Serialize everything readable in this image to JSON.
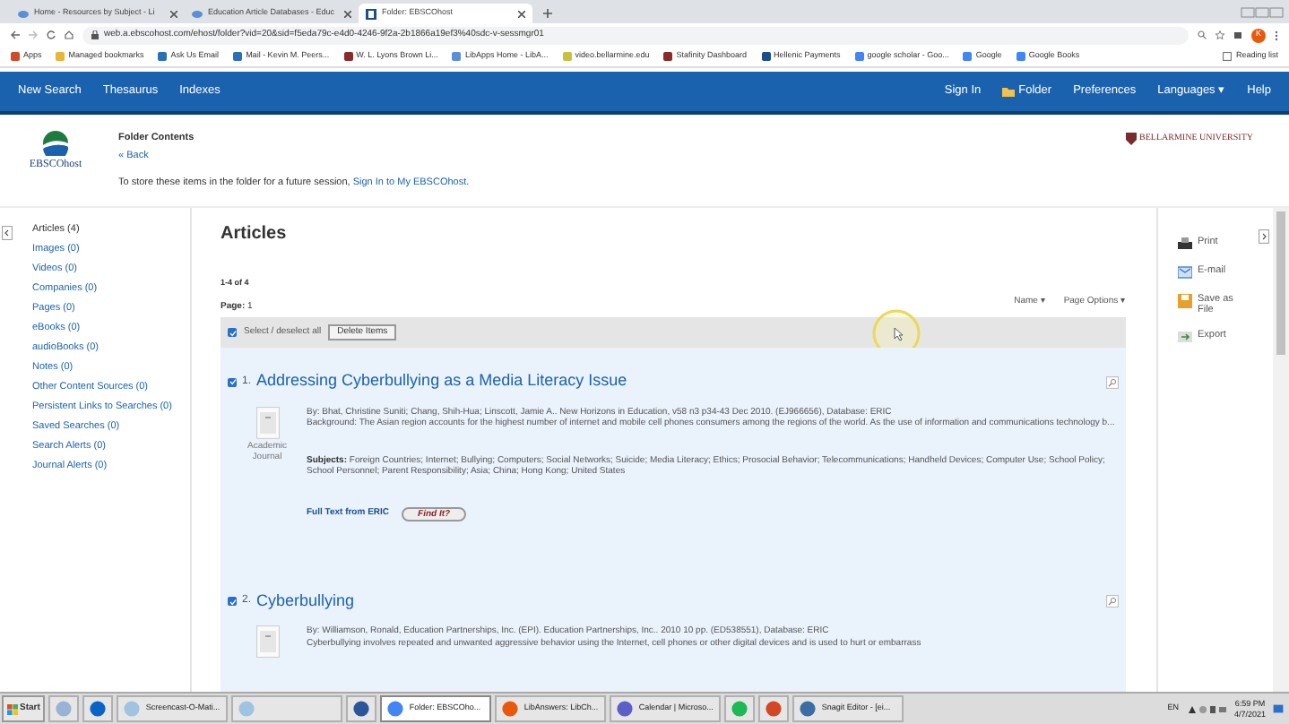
{
  "browser": {
    "tabs": [
      {
        "title": "Home - Resources by Subject - Li",
        "selected": false
      },
      {
        "title": "Education Article Databases - Educ",
        "selected": false
      },
      {
        "title": "Folder: EBSCOhost",
        "selected": true
      }
    ],
    "url": "web.a.ebscohost.com/ehost/folder?vid=20&sid=f5eda79c-e4d0-4246-9f2a-2b1866a19ef3%40sdc-v-sessmgr01",
    "profile_initial": "K",
    "bookmarks": [
      "Apps",
      "Managed bookmarks",
      "Ask Us Email",
      "Mail - Kevin M. Peers...",
      "W. L. Lyons Brown Li...",
      "LibApps Home - LibA...",
      "video.bellarmine.edu",
      "Stafinity Dashboard",
      "Hellenic Payments",
      "google scholar - Goo...",
      "Google",
      "Google Books"
    ],
    "reading_list": "Reading list"
  },
  "nav": {
    "left": [
      "New Search",
      "Thesaurus",
      "Indexes"
    ],
    "right": [
      "Sign In",
      "Folder",
      "Preferences",
      "Languages ▾",
      "Help"
    ]
  },
  "header": {
    "logo": "EBSCOhost",
    "title": "Folder Contents",
    "back": "« Back",
    "note": "To store these items in the folder for a future session, ",
    "note_link": "Sign In to My EBSCOhost.",
    "university": "BELLARMINE UNIVERSITY"
  },
  "sidebar": {
    "items": [
      {
        "label": "Articles",
        "count": "(4)",
        "selected": true
      },
      {
        "label": "Images",
        "count": "(0)",
        "selected": false
      },
      {
        "label": "Videos",
        "count": "(0)",
        "selected": false
      },
      {
        "label": "Companies",
        "count": "(0)",
        "selected": false
      },
      {
        "label": "Pages",
        "count": "(0)",
        "selected": false
      },
      {
        "label": "eBooks",
        "count": "(0)",
        "selected": false
      },
      {
        "label": "audioBooks",
        "count": "(0)",
        "selected": false
      },
      {
        "label": "Notes",
        "count": "(0)",
        "selected": false
      },
      {
        "label": "Other Content Sources",
        "count": "(0)",
        "selected": false
      },
      {
        "label": "Persistent Links to Searches",
        "count": "(0)",
        "selected": false
      },
      {
        "label": "Saved Searches",
        "count": "(0)",
        "selected": false
      },
      {
        "label": "Search Alerts",
        "count": "(0)",
        "selected": false
      },
      {
        "label": "Journal Alerts",
        "count": "(0)",
        "selected": false
      }
    ]
  },
  "main": {
    "heading": "Articles",
    "range": "1-4 of 4",
    "page_label": "Page:",
    "page": "1",
    "sort": "Name ▾",
    "page_options": "Page Options ▾",
    "select_all": {
      "label": "Select / deselect all",
      "checked": true
    },
    "delete_button": "Delete Items",
    "results": [
      {
        "number": "1.",
        "title": "Addressing Cyberbullying as a Media Literacy Issue",
        "checked": true,
        "type": "Academic Journal",
        "byline": "By: Bhat, Christine Suniti; Chang, Shih-Hua; Linscott, Jamie A.. New Horizons in Education, v58 n3 p34-43 Dec 2010. (EJ966656), Database: ERIC",
        "abstract": "Background: The Asian region accounts for the highest number of internet and mobile cell phones consumers among the regions of the world. As the use of information and communications technology b...",
        "subjects_label": "Subjects:",
        "subjects": "Foreign Countries; Internet; Bullying; Computers; Social Networks; Suicide; Media Literacy; Ethics; Prosocial Behavior; Telecommunications; Handheld Devices; Computer Use; School Policy; School Personnel; Parent Responsibility; Asia; China; Hong Kong; United States",
        "full_text": "Full Text from ERIC",
        "find_button": "Find It?"
      },
      {
        "number": "2.",
        "title": "Cyberbullying",
        "checked": true,
        "byline": "By: Williamson, Ronald, Education Partnerships, Inc. (EPI). Education Partnerships, Inc.. 2010 10 pp. (ED538551), Database: ERIC",
        "abstract": "Cyberbullying involves repeated and unwanted aggressive behavior using the Internet, cell phones or other digital devices and is used to hurt or embarrass"
      }
    ]
  },
  "tools": [
    {
      "kind": "print",
      "label": "Print"
    },
    {
      "kind": "email",
      "label": "E-mail"
    },
    {
      "kind": "save",
      "label": "Save as File"
    },
    {
      "kind": "export",
      "label": "Export"
    }
  ],
  "taskbar": {
    "start": "Start",
    "items": [
      {
        "kind": "files",
        "selected": false
      },
      {
        "kind": "outlook",
        "selected": false
      },
      {
        "kind": "screencast",
        "label": "Screencast-O-Mati...",
        "selected": false
      },
      {
        "kind": "window",
        "selected": false
      },
      {
        "kind": "word",
        "selected": false
      },
      {
        "kind": "chrome",
        "label": "Folder: EBSCOho...",
        "selected": true
      },
      {
        "kind": "firefox",
        "label": "LibAnswers: LibCh...",
        "selected": false
      },
      {
        "kind": "teams",
        "label": "Calendar | Microso...",
        "selected": false
      },
      {
        "kind": "spotify",
        "selected": false
      },
      {
        "kind": "powerpoint",
        "selected": false
      },
      {
        "kind": "snagit",
        "label": "Snagit Editor - [ei...",
        "selected": false
      }
    ],
    "language": "EN",
    "time": "6:59 PM",
    "date": "4/7/2021"
  }
}
